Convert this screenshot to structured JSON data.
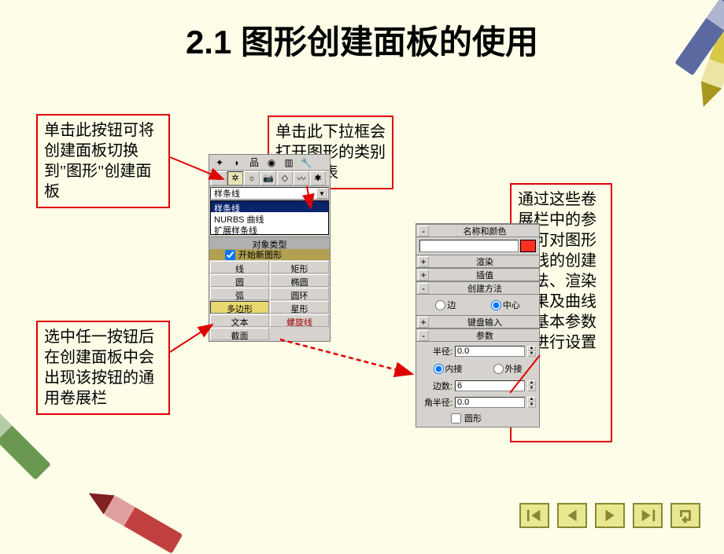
{
  "title_num": "2.1",
  "title_text": "图形创建面板的使用",
  "callout1": "单击此按钮可将创建面板切换到\"图形\"创建面板",
  "callout2": "单击此下拉框会打开图形的类别下拉列表",
  "callout3": "通过这些卷展栏中的参数可对图形曲线的创建方法、渲染效果及曲线的基本参数等进行设置",
  "callout4": "选中任一按钮后在创建面板中会出现该按钮的通用卷展栏",
  "dropdown_sel": "样条线",
  "dropdown_items": [
    "样条线",
    "NURBS 曲线",
    "扩展样条线"
  ],
  "obj_header": "对象类型",
  "start_new": "开始新图形",
  "shapes": {
    "r1c1": "线",
    "r1c2": "矩形",
    "r2c1": "圆",
    "r2c2": "椭圆",
    "r3c1": "弧",
    "r3c2": "圆环",
    "r4c1": "多边形",
    "r4c2": "星形",
    "r5c1": "文本",
    "r5c2": "螺旋线",
    "r6c1": "截面"
  },
  "params": {
    "name_color": "名称和颜色",
    "render": "渲染",
    "interp": "插值",
    "create_method": "创建方法",
    "edge": "边",
    "center": "中心",
    "keyboard": "键盘输入",
    "params": "参数",
    "radius": "半径:",
    "radius_val": "0.0",
    "inscribed": "内接",
    "circum": "外接",
    "sides": "边数:",
    "sides_val": "6",
    "corner_radius": "角半径:",
    "corner_radius_val": "0.0",
    "circular": "圆形"
  }
}
